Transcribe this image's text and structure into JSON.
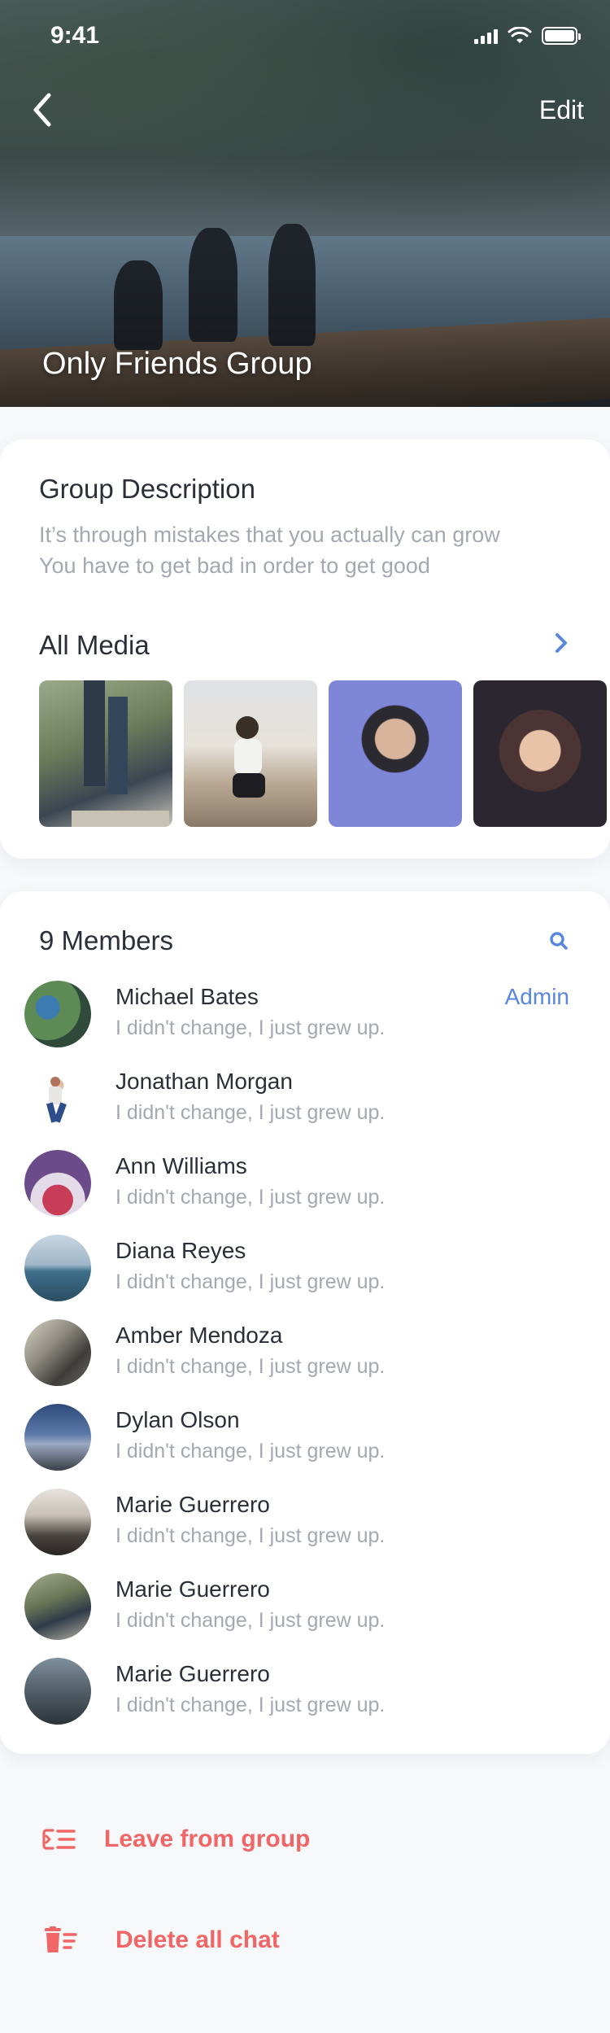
{
  "status_bar": {
    "time": "9:41"
  },
  "nav": {
    "edit_label": "Edit"
  },
  "group": {
    "title": "Only Friends Group"
  },
  "description": {
    "title": "Group Description",
    "line1": "It’s through mistakes that you actually can grow",
    "line2": "You have to get bad in order to get good"
  },
  "media": {
    "title": "All Media",
    "thumbnails": [
      "media-thumb-1",
      "media-thumb-2",
      "media-thumb-3",
      "media-thumb-4"
    ]
  },
  "members": {
    "title": "9 Members",
    "items": [
      {
        "name": "Michael Bates",
        "status": "I didn't change, I just grew up.",
        "role": "Admin"
      },
      {
        "name": "Jonathan Morgan",
        "status": "I didn't change, I just grew up."
      },
      {
        "name": "Ann Williams",
        "status": "I didn't change, I just grew up."
      },
      {
        "name": "Diana Reyes",
        "status": "I didn't change, I just grew up."
      },
      {
        "name": "Amber Mendoza",
        "status": "I didn't change, I just grew up."
      },
      {
        "name": "Dylan Olson",
        "status": "I didn't change, I just grew up."
      },
      {
        "name": "Marie Guerrero",
        "status": "I didn't change, I just grew up."
      },
      {
        "name": "Marie Guerrero",
        "status": "I didn't change, I just grew up."
      },
      {
        "name": "Marie Guerrero",
        "status": "I didn't change, I just grew up."
      }
    ]
  },
  "actions": {
    "leave_label": "Leave from group",
    "delete_label": "Delete all chat"
  },
  "colors": {
    "accent": "#5a86e0",
    "danger": "#f06565",
    "text_primary": "#2b2f38",
    "text_secondary": "#a4a8b1"
  },
  "icons": {
    "back": "chevron-left-icon",
    "media_more": "chevron-right-icon",
    "search": "search-icon",
    "leave": "leave-group-icon",
    "delete": "trash-icon"
  }
}
